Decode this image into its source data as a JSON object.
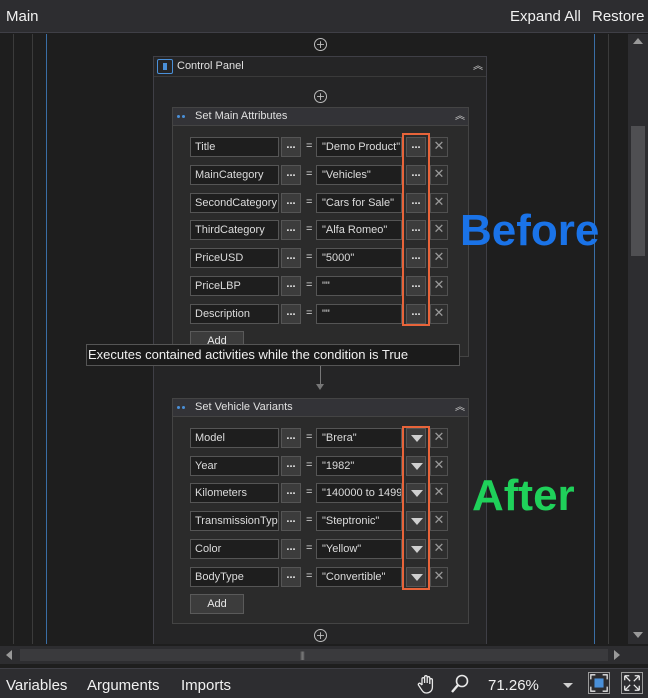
{
  "header": {
    "title": "Main",
    "expand_all": "Expand All",
    "restore": "Restore"
  },
  "control_panel": {
    "title": "Control Panel"
  },
  "main_attributes": {
    "title": "Set Main Attributes",
    "rows": [
      {
        "name": "Title",
        "value": "\"Demo Product\""
      },
      {
        "name": "MainCategory",
        "value": "\"Vehicles\""
      },
      {
        "name": "SecondCategory",
        "value": "\"Cars for Sale\""
      },
      {
        "name": "ThirdCategory",
        "value": "\"Alfa Romeo\""
      },
      {
        "name": "PriceUSD",
        "value": "\"5000\""
      },
      {
        "name": "PriceLBP",
        "value": "\"\""
      },
      {
        "name": "Description",
        "value": "\"\""
      }
    ],
    "add_label": "Add"
  },
  "vehicle_variants": {
    "title": "Set Vehicle Variants",
    "rows": [
      {
        "name": "Model",
        "value": "\"Brera\""
      },
      {
        "name": "Year",
        "value": "\"1982\""
      },
      {
        "name": "Kilometers",
        "value": "\"140000 to 1499"
      },
      {
        "name": "TransmissionType",
        "value": "\"Steptronic\""
      },
      {
        "name": "Color",
        "value": "\"Yellow\""
      },
      {
        "name": "BodyType",
        "value": "\"Convertible\""
      }
    ],
    "add_label": "Add"
  },
  "common": {
    "ellipsis": "...",
    "equals": "=",
    "delete_glyph": "✕",
    "plus_glyph": "+",
    "collapse_glyph": "︽"
  },
  "tooltip": "Executes contained activities while the condition is True",
  "annotations": {
    "before": "Before",
    "after": "After",
    "before_color": "#1a73e8",
    "after_color": "#1fd15a"
  },
  "status_bar": {
    "variables": "Variables",
    "arguments": "Arguments",
    "imports": "Imports",
    "zoom": "71.26%"
  },
  "icons": [
    "hand-pan-icon",
    "zoom-search-icon",
    "fit-screen-icon",
    "full-screen-icon"
  ]
}
